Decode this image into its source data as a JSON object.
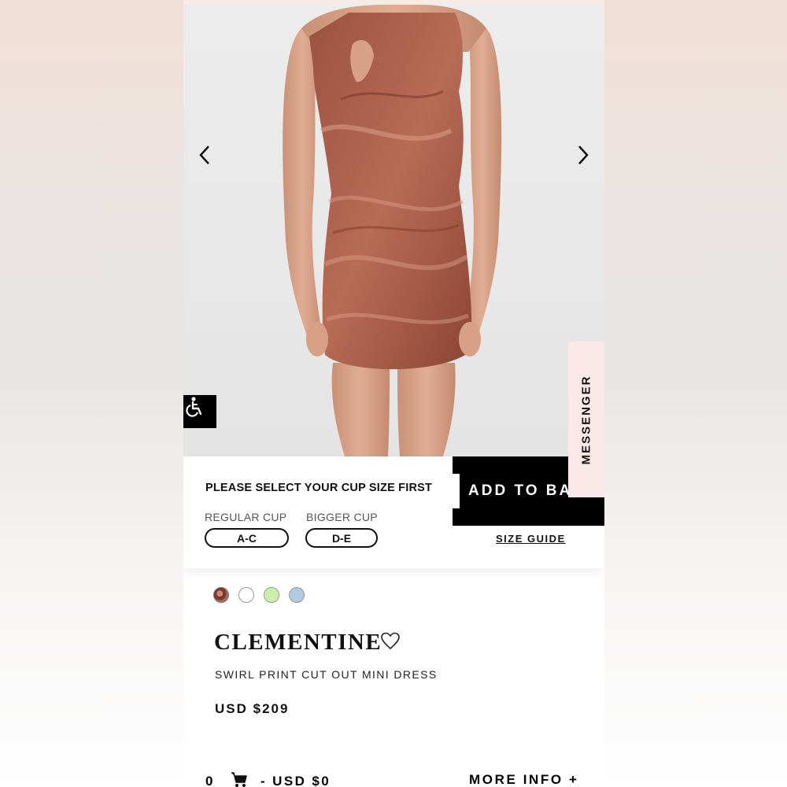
{
  "gallery": {
    "prev_icon": "chevron-left-icon",
    "next_icon": "chevron-right-icon",
    "accessibility_icon": "accessibility-icon"
  },
  "messenger": {
    "label": "MESSENGER"
  },
  "cup_selector": {
    "prompt": "PLEASE SELECT YOUR CUP SIZE FIRST",
    "options": [
      {
        "group": "REGULAR CUP",
        "size": "A-C"
      },
      {
        "group": "BIGGER CUP",
        "size": "D-E"
      }
    ],
    "add_to_bag_label": "ADD TO BA",
    "size_guide_label": "SIZE GUIDE"
  },
  "swatches": [
    {
      "name": "swirl-print",
      "color": "#8b4a3c"
    },
    {
      "name": "white",
      "color": "#ffffff"
    },
    {
      "name": "lime",
      "color": "#c9f0a6"
    },
    {
      "name": "blue",
      "color": "#b1cbe3"
    }
  ],
  "product": {
    "name": "CLEMENTINE",
    "description": "SWIRL PRINT CUT OUT MINI DRESS",
    "price": "USD $209",
    "wishlist_icon": "heart-icon"
  },
  "footer": {
    "cart_count": "0",
    "cart_icon": "cart-icon",
    "cart_total": "- USD $0",
    "more_info_label": "MORE INFO +"
  }
}
